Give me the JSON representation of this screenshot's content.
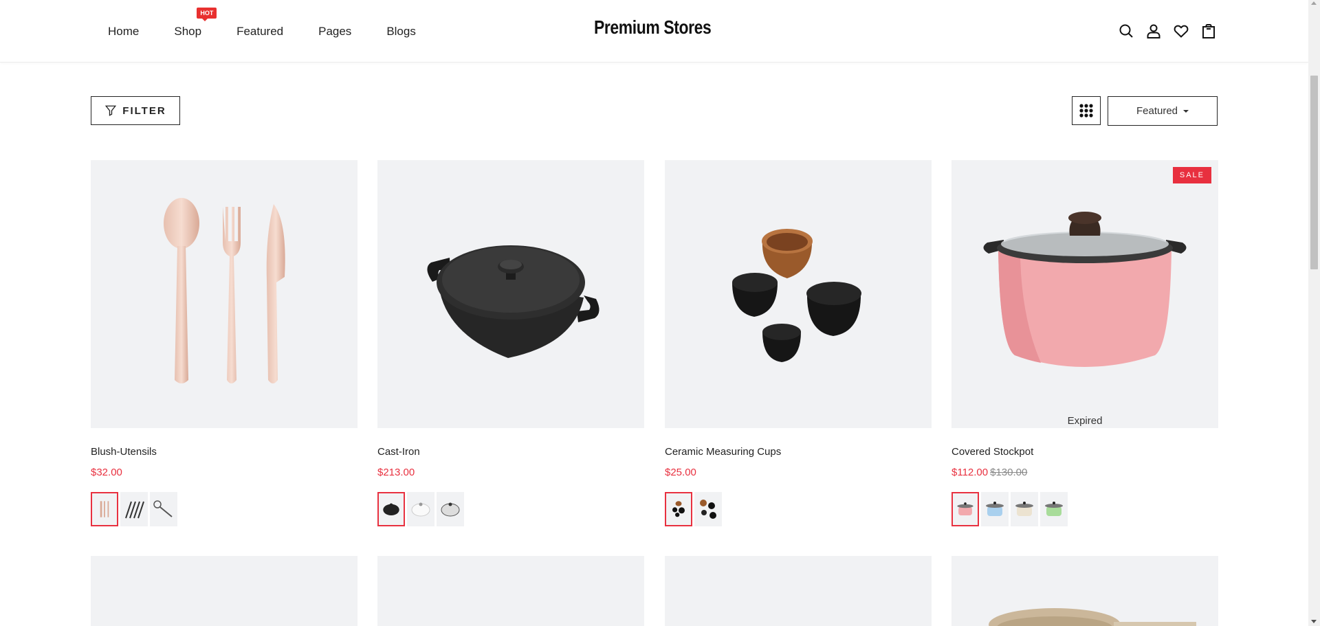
{
  "header": {
    "nav": [
      {
        "label": "Home"
      },
      {
        "label": "Shop",
        "badge": "HOT"
      },
      {
        "label": "Featured"
      },
      {
        "label": "Pages"
      },
      {
        "label": "Blogs"
      }
    ],
    "logo": "Premium Stores",
    "icons": [
      "search-icon",
      "user-icon",
      "heart-icon",
      "shopping-bag-icon"
    ]
  },
  "toolbar": {
    "filter_label": "FILTER",
    "sort_selected": "Featured"
  },
  "colors": {
    "accent": "#e8303f",
    "tile_bg": "#f1f2f4"
  },
  "products": [
    {
      "title": "Blush-Utensils",
      "price": "$32.00",
      "swatch_count": 3
    },
    {
      "title": "Cast-Iron",
      "price": "$213.00",
      "swatch_count": 3
    },
    {
      "title": "Ceramic Measuring Cups",
      "price": "$25.00",
      "swatch_count": 2
    },
    {
      "title": "Covered Stockpot",
      "price": "$112.00",
      "compare_price": "$130.00",
      "badge": "SALE",
      "status": "Expired",
      "swatch_count": 4
    }
  ]
}
